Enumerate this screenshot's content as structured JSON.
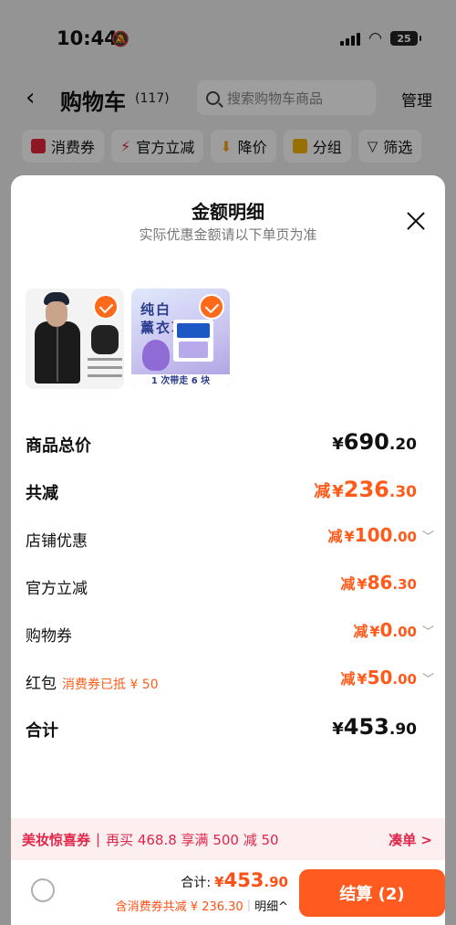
{
  "status_bar": {
    "time": "10:44",
    "battery": "25"
  },
  "header": {
    "back_icon": "back-arrow-icon",
    "title": "购物车",
    "count": "(117)",
    "search_placeholder": "搜索购物车商品",
    "manage": "管理"
  },
  "filters": [
    {
      "label": "消费券",
      "icon": "coupon-icon",
      "color": "#e5263a"
    },
    {
      "label": "官方立减",
      "icon": "lightning-icon",
      "color": "#e5263a"
    },
    {
      "label": "降价",
      "icon": "down-arrow-icon",
      "color": "#f5a623"
    },
    {
      "label": "分组",
      "icon": "folder-icon",
      "color": "#f5b400"
    },
    {
      "label": "筛选",
      "icon": "filter-icon",
      "color": "#333333"
    }
  ],
  "sheet": {
    "title": "金额明细",
    "subtitle": "实际优惠金额请以下单页为准",
    "products": [
      {
        "name": "black-jacket-product"
      },
      {
        "name": "soap-product",
        "line1": "纯白",
        "line2": "薰衣草",
        "band": "1 次带走 6 块"
      }
    ],
    "rows": {
      "goods_total": {
        "label": "商品总价",
        "cur": "¥",
        "int": "690",
        "dec": ".20"
      },
      "total_discount": {
        "label": "共减",
        "prefix": "减",
        "cur": "¥",
        "int": "236",
        "dec": ".30"
      },
      "shop_discount": {
        "label": "店铺优惠",
        "prefix": "减",
        "cur": "¥",
        "int": "100",
        "dec": ".00"
      },
      "official_discount": {
        "label": "官方立减",
        "prefix": "减",
        "cur": "¥",
        "int": "86",
        "dec": ".30"
      },
      "shopping_coupon": {
        "label": "购物券",
        "prefix": "减",
        "cur": "¥",
        "int": "0",
        "dec": ".00"
      },
      "red_packet": {
        "label": "红包",
        "note": "消费券已抵 ¥ 50",
        "prefix": "减",
        "cur": "¥",
        "int": "50",
        "dec": ".00"
      },
      "sum": {
        "label": "合计",
        "cur": "¥",
        "int": "453",
        "dec": ".90"
      }
    }
  },
  "promo": {
    "title": "美妆惊喜券",
    "text": "再买 468.8 享满 500 减 50",
    "action": "凑单 >"
  },
  "footer": {
    "total_label": "合计:",
    "cur": "¥",
    "int": "453",
    "dec": ".90",
    "discount_text": "含消费券共减 ¥ 236.30",
    "detail": "明细^",
    "checkout": "结算 (2)"
  },
  "colors": {
    "accent": "#ff5a1f",
    "promo_text": "#e0264a",
    "promo_bg": "#fdeef0"
  }
}
